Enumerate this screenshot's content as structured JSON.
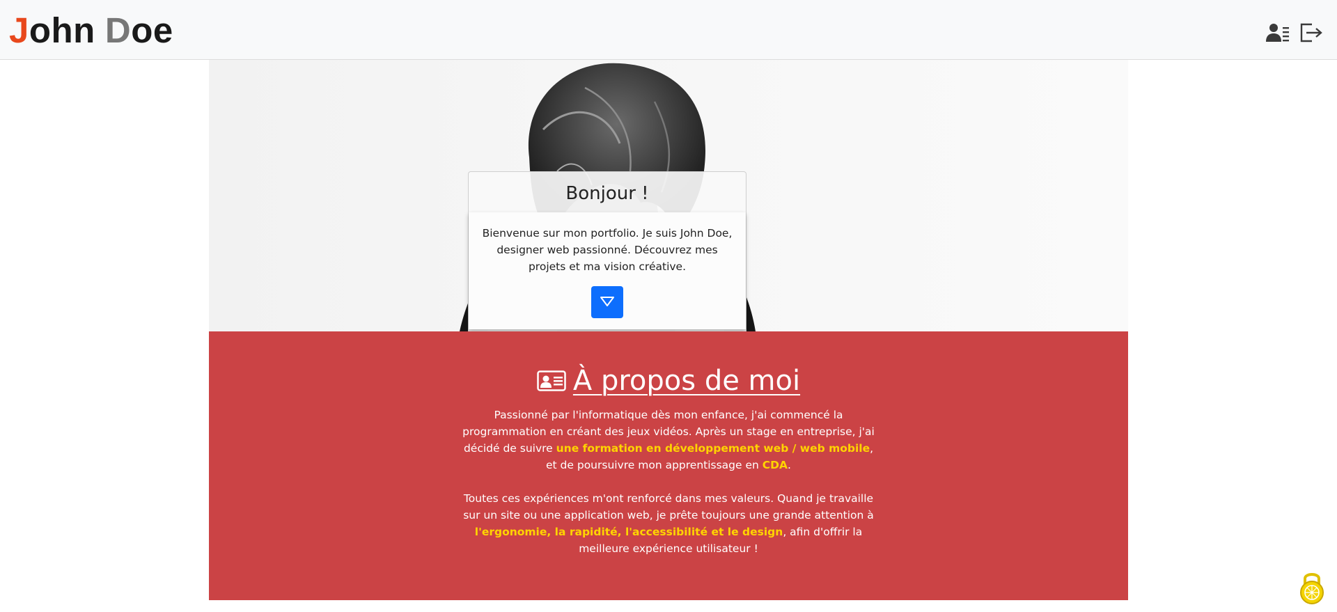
{
  "header": {
    "logo": {
      "first_initial": "J",
      "first_rest": "ohn",
      "last_initial": "D",
      "last_rest": "oe"
    },
    "icons": [
      "user-list-icon",
      "logout-icon"
    ]
  },
  "hero": {
    "card_title": "Bonjour !",
    "card_text": "Bienvenue sur mon portfolio. Je suis John Doe, designer web passionné. Découvrez mes projets et ma vision créative.",
    "scroll_button_icon": "triangle-down-icon"
  },
  "about": {
    "title": "À propos de moi",
    "title_icon": "id-card-icon",
    "p1": {
      "a": "Passionné par l'informatique dès mon enfance, j'ai commencé la programmation en créant des jeux vidéos. Après un stage en entreprise, j'ai décidé de suivre ",
      "hl1": "une formation en développement web / web mobile",
      "b": ", et de poursuivre mon apprentissage en ",
      "hl2": "CDA",
      "c": "."
    },
    "p2": {
      "a": "Toutes ces expériences m'ont renforcé dans mes valeurs. Quand je travaille sur un site ou une application web, je prête toujours une grande attention à ",
      "hl1": "l'ergonomie, la rapidité, l'accessibilité et le design",
      "b": ", afin d'offrir la meilleure expérience utilisateur !"
    }
  },
  "colors": {
    "accent_orange": "#e8481c",
    "about_bg": "#cb4345",
    "highlight": "#ffd400",
    "button_blue": "#0d6efd"
  },
  "floating": {
    "icon": "lock-icon"
  }
}
